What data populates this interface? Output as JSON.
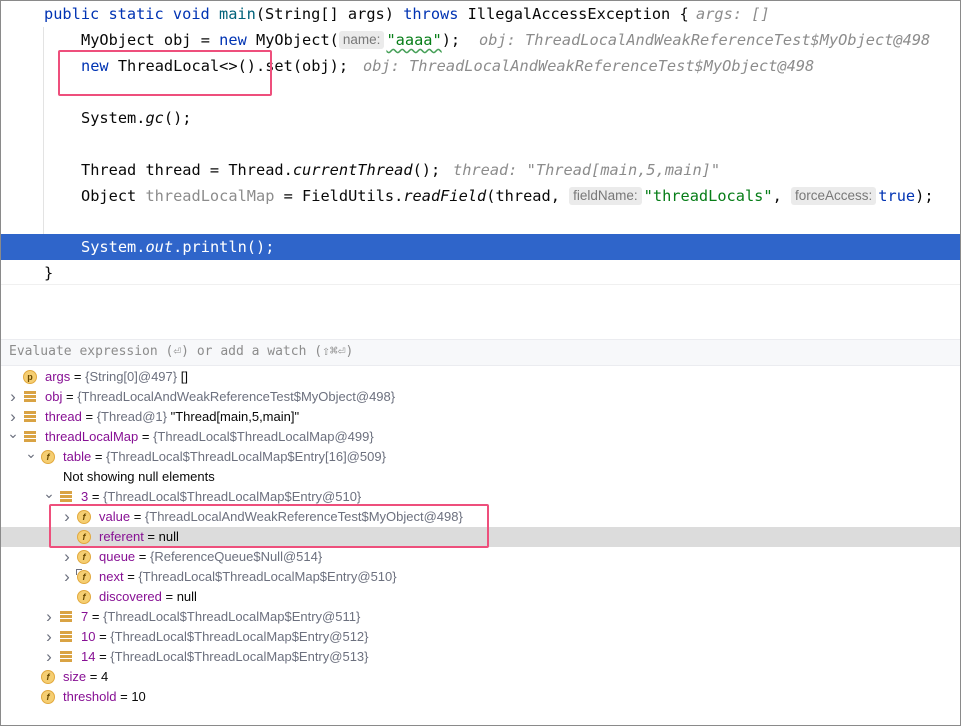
{
  "editor": {
    "line1": {
      "kw1": "public static void ",
      "fn": "main",
      "p1": "(String[] args) ",
      "kw2": "throws",
      "p2": " IllegalAccessException {",
      "inline": "args: []"
    },
    "line2": {
      "a": "MyObject obj = ",
      "kw": "new",
      "b": " MyObject(",
      "hint": "name:",
      "str": "\"aaaa\"",
      "c": ");",
      "inline": "obj: ThreadLocalAndWeakReferenceTest$MyObject@498"
    },
    "line3": {
      "kw": "new",
      "a": " ThreadLocal<>().set(obj);",
      "inline": "obj: ThreadLocalAndWeakReferenceTest$MyObject@498"
    },
    "line4": {
      "a": "System.",
      "it": "gc",
      "b": "();"
    },
    "line5": {
      "a": "Thread thread = Thread.",
      "it": "currentThread",
      "b": "();",
      "inline": "thread: \"Thread[main,5,main]\""
    },
    "line6": {
      "a": "Object ",
      "unused": "threadLocalMap",
      "b": " = FieldUtils.",
      "it": "readField",
      "c": "(thread, ",
      "hint1": "fieldName:",
      "str": "\"threadLocals\"",
      "d": ", ",
      "hint2": "forceAccess:",
      "kw": "true",
      "e": ");"
    },
    "line7": {
      "a": "System.",
      "fld": "out",
      "b": ".println();"
    },
    "line8": {
      "a": "}"
    }
  },
  "watch": {
    "placeholder": "Evaluate expression (⏎) or add a watch (⇧⌘⏎)"
  },
  "tree": [
    {
      "id": "args",
      "name": "args",
      "type": "{String[0]@497}",
      "value": " []",
      "expander": "",
      "icon": "param"
    },
    {
      "id": "obj",
      "name": "obj",
      "type": "{ThreadLocalAndWeakReferenceTest$MyObject@498}",
      "value": "",
      "expander": "collapsed",
      "icon": "list"
    },
    {
      "id": "thread",
      "name": "thread",
      "type": "{Thread@1}",
      "value": " \"Thread[main,5,main]\"",
      "expander": "collapsed",
      "icon": "list"
    },
    {
      "id": "threadLocalMap",
      "name": "threadLocalMap",
      "type": "{ThreadLocal$ThreadLocalMap@499}",
      "value": "",
      "expander": "expanded",
      "icon": "list"
    },
    {
      "id": "table",
      "name": "table",
      "type": "{ThreadLocal$ThreadLocalMap$Entry[16]@509}",
      "value": "",
      "expander": "expanded",
      "icon": "field"
    },
    {
      "id": "not-showing-null",
      "text": "Not showing null elements"
    },
    {
      "id": "entry-3",
      "name": "3",
      "type": "{ThreadLocal$ThreadLocalMap$Entry@510}",
      "value": "",
      "expander": "expanded",
      "icon": "list"
    },
    {
      "id": "value",
      "name": "value",
      "type": "{ThreadLocalAndWeakReferenceTest$MyObject@498}",
      "value": "",
      "expander": "collapsed",
      "icon": "field"
    },
    {
      "id": "referent",
      "name": "referent",
      "type": "",
      "value": "null",
      "expander": "",
      "icon": "field"
    },
    {
      "id": "queue",
      "name": "queue",
      "type": "{ReferenceQueue$Null@514}",
      "value": "",
      "expander": "collapsed",
      "icon": "field"
    },
    {
      "id": "next",
      "name": "next",
      "type": "{ThreadLocal$ThreadLocalMap$Entry@510}",
      "value": "",
      "expander": "collapsed",
      "icon": "field-final"
    },
    {
      "id": "discovered",
      "name": "discovered",
      "type": "",
      "value": "null",
      "expander": "",
      "icon": "field"
    },
    {
      "id": "entry-7",
      "name": "7",
      "type": "{ThreadLocal$ThreadLocalMap$Entry@511}",
      "value": "",
      "expander": "collapsed",
      "icon": "list"
    },
    {
      "id": "entry-10",
      "name": "10",
      "type": "{ThreadLocal$ThreadLocalMap$Entry@512}",
      "value": "",
      "expander": "collapsed",
      "icon": "list"
    },
    {
      "id": "entry-14",
      "name": "14",
      "type": "{ThreadLocal$ThreadLocalMap$Entry@513}",
      "value": "",
      "expander": "collapsed",
      "icon": "list"
    },
    {
      "id": "size",
      "name": "size",
      "type": "",
      "value": "4",
      "expander": "",
      "icon": "field"
    },
    {
      "id": "threshold",
      "name": "threshold",
      "type": "",
      "value": "10",
      "expander": "",
      "icon": "field"
    }
  ],
  "colors": {
    "selection": "#2f65ca",
    "highlight_box": "#ee4f7c",
    "tree_selection": "#dcdcdc"
  },
  "icons": {
    "expanded": "chevron-down-icon",
    "collapsed": "chevron-right-icon",
    "field": "field-icon",
    "param": "parameter-icon",
    "list": "variable-icon"
  }
}
